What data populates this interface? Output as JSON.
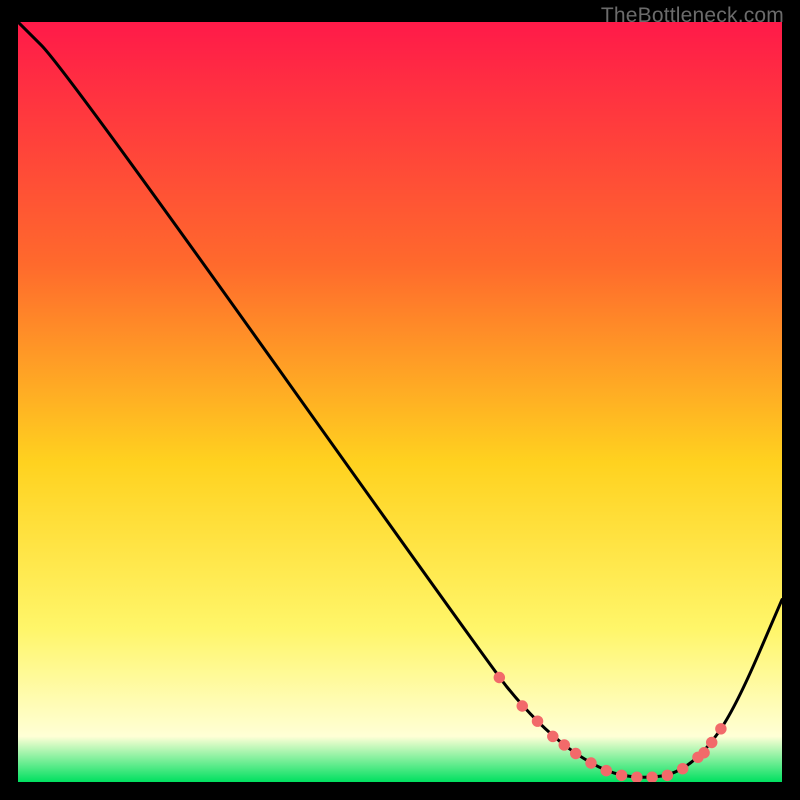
{
  "watermark": "TheBottleneck.com",
  "gradient": {
    "top": "#ff1a49",
    "upper_mid": "#ff6a2c",
    "mid": "#ffd21f",
    "lower_mid": "#fff66a",
    "near_bottom": "#ffffd6",
    "bottom": "#00e060"
  },
  "chart_data": {
    "type": "line",
    "title": "",
    "xlabel": "",
    "ylabel": "",
    "xlim": [
      0,
      100
    ],
    "ylim": [
      0,
      100
    ],
    "x": [
      0,
      6,
      62,
      66,
      70,
      74,
      78,
      82,
      86,
      90,
      94,
      100
    ],
    "values": [
      100,
      94,
      15,
      10,
      6,
      3,
      1,
      0.5,
      1,
      4,
      10,
      24
    ],
    "flat_basin_x_range": [
      66,
      90
    ],
    "markers_x": [
      63,
      66,
      68,
      70,
      71.5,
      73,
      75,
      77,
      79,
      81,
      83,
      85,
      87,
      89,
      89.8,
      90.8,
      92
    ],
    "marker_color": "#f26a6a",
    "marker_radius_pct": 0.75,
    "axes_visible": false
  }
}
